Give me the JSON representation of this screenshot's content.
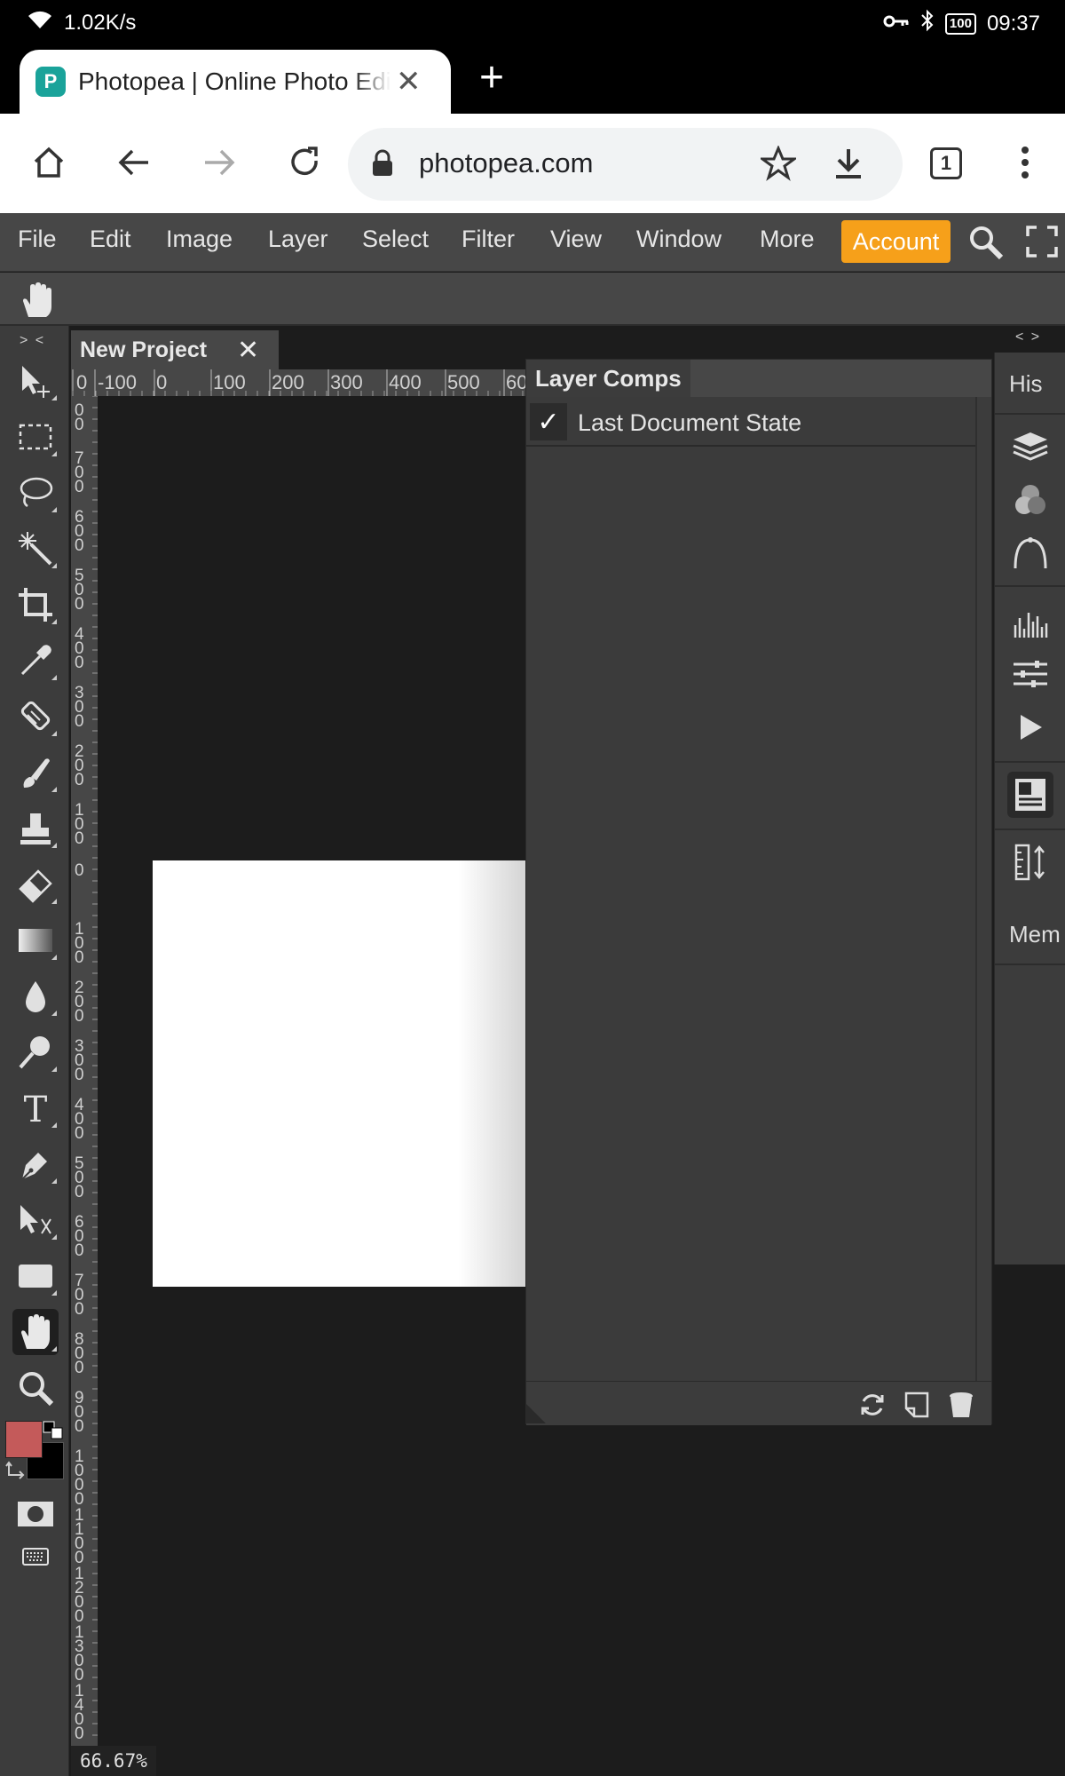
{
  "status_bar": {
    "network_speed": "1.02K/s",
    "battery": "100",
    "time": "09:37"
  },
  "browser": {
    "tab_title": "Photopea | Online Photo Editor",
    "favicon_letter": "P",
    "url": "photopea.com",
    "tab_count": "1"
  },
  "menu": {
    "items": [
      "File",
      "Edit",
      "Image",
      "Layer",
      "Select",
      "Filter",
      "View",
      "Window",
      "More"
    ],
    "account_label": "Account"
  },
  "toolbar": {
    "collapse_label": "> <",
    "tools": [
      "move-tool",
      "rectangle-select-tool",
      "lasso-tool",
      "magic-wand-tool",
      "crop-tool",
      "eyedropper-tool",
      "spot-healing-tool",
      "brush-tool",
      "clone-stamp-tool",
      "eraser-tool",
      "gradient-tool",
      "blur-tool",
      "dodge-tool",
      "type-tool",
      "pen-tool",
      "path-select-tool",
      "rectangle-tool",
      "hand-tool",
      "zoom-tool"
    ],
    "foreground_color": "#c45a5a",
    "background_color": "#000000"
  },
  "document": {
    "tab_title": "New Project",
    "zoom": "66.67%",
    "ruler_h_labels": [
      "0",
      "-100",
      "0",
      "100",
      "200",
      "300",
      "400",
      "500",
      "60"
    ],
    "ruler_v_labels": [
      "0 0",
      "7 0 0",
      "6 0 0",
      "5 0 0",
      "4 0 0",
      "3 0 0",
      "2 0 0",
      "1 0 0",
      "0",
      "1 0 0",
      "2 0 0",
      "3 0 0",
      "4 0 0",
      "5 0 0",
      "6 0 0",
      "7 0 0",
      "8 0 0",
      "9 0 0",
      "1 0 0 0",
      "1 1 0 0",
      "1 2 0 0",
      "1 3 0 0",
      "1 4 0 0"
    ]
  },
  "layer_comps_panel": {
    "title": "Layer Comps",
    "items": [
      {
        "label": "Last Document State",
        "checked": true
      }
    ]
  },
  "right_dock": {
    "collapse_label": "< >",
    "history_label": "His",
    "memory_label": "Mem"
  },
  "colors": {
    "accent": "#f6a01a",
    "panel_bg": "#3c3c3c",
    "app_bg": "#1c1c1c",
    "menubar_bg": "#474747"
  }
}
